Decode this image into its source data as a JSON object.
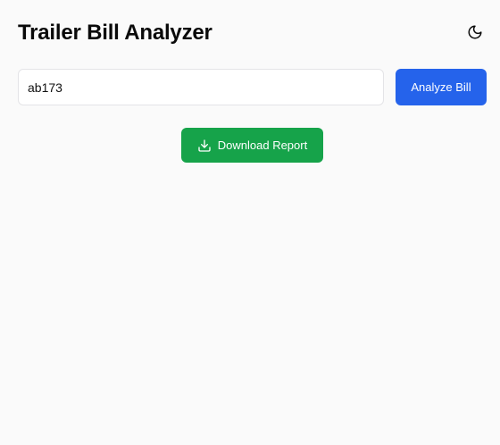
{
  "header": {
    "title": "Trailer Bill Analyzer",
    "theme_icon": "moon-icon"
  },
  "form": {
    "input_value": "ab173",
    "analyze_label": "Analyze Bill"
  },
  "actions": {
    "download_label": "Download Report",
    "download_icon": "download-icon"
  },
  "colors": {
    "background": "#fafafa",
    "primary": "#2563eb",
    "success": "#16a34a"
  }
}
